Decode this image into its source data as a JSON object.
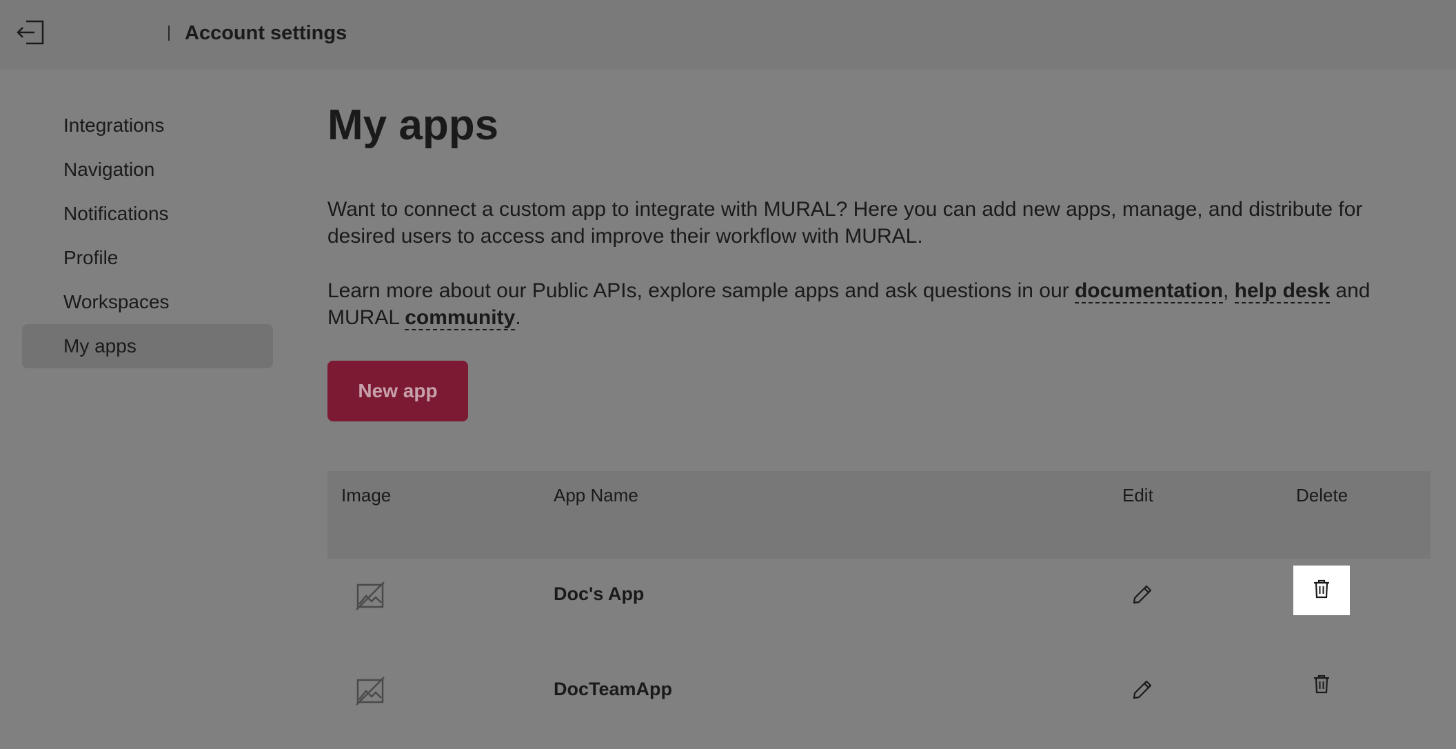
{
  "header": {
    "title": "Account settings"
  },
  "sidebar": {
    "items": [
      {
        "label": "Integrations"
      },
      {
        "label": "Navigation"
      },
      {
        "label": "Notifications"
      },
      {
        "label": "Profile"
      },
      {
        "label": "Workspaces"
      },
      {
        "label": "My apps",
        "active": true
      }
    ]
  },
  "main": {
    "title": "My apps",
    "intro": "Want to connect a custom app to integrate with MURAL? Here you can add new apps, manage, and distribute for desired users to access and improve their workflow with MURAL.",
    "learn_prefix": "Learn more about our Public APIs, explore sample apps and ask questions in our",
    "link_documentation": "documentation",
    "comma": ",",
    "link_helpdesk": "help desk",
    "and_mural": "and MURAL",
    "link_community": "community",
    "period": ".",
    "new_app_label": "New app"
  },
  "table": {
    "headers": {
      "image": "Image",
      "name": "App Name",
      "edit": "Edit",
      "delete": "Delete"
    },
    "rows": [
      {
        "name": "Doc's App"
      },
      {
        "name": "DocTeamApp"
      }
    ]
  },
  "colors": {
    "accent": "#7b1a32",
    "overlay": "#808080"
  },
  "icons": {
    "exit": "exit-icon",
    "image_placeholder": "image-placeholder-icon",
    "edit": "pencil-icon",
    "delete": "trash-icon"
  }
}
